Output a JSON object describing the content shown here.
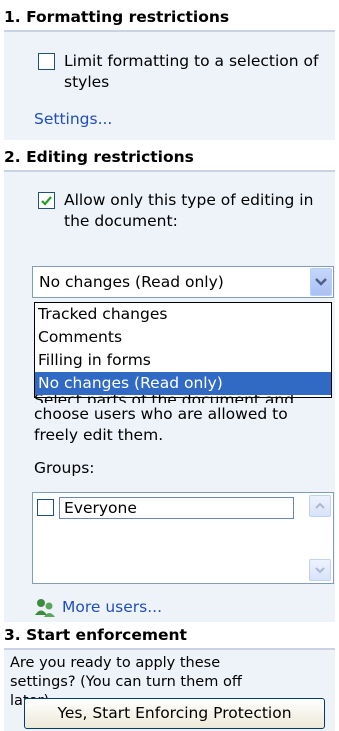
{
  "sections": {
    "formatting": {
      "title": "1. Formatting restrictions",
      "checkbox_line1": "Limit formatting to a selection of",
      "checkbox_line2": "styles",
      "checked": false,
      "settings_link": "Settings..."
    },
    "editing": {
      "title": "2. Editing restrictions",
      "checkbox_line1": "Allow only this type of editing in",
      "checkbox_line2": "the document:",
      "checked": true,
      "dropdown_value": "No changes (Read only)",
      "options": [
        "Tracked changes",
        "Comments",
        "Filling in forms",
        "No changes (Read only)"
      ],
      "selected_index": 3,
      "partial_hidden_line": "Select parts of the document and",
      "help_line1": "choose users who are allowed to",
      "help_line2": "freely edit them.",
      "groups_label": "Groups:",
      "groups": [
        "Everyone"
      ],
      "more_users_link": "More users..."
    },
    "enforcement": {
      "title": "3. Start enforcement",
      "text_line1": "Are you ready to apply these",
      "text_line2": "settings? (You can turn them off",
      "text_line3": "later)",
      "button_label": "Yes, Start Enforcing Protection"
    }
  },
  "colors": {
    "section_bg": "#eef2f9",
    "link": "#1f4fbf",
    "selection": "#316ac5",
    "check": "#21a121"
  },
  "icons": {
    "more_users": "users-icon",
    "dropdown": "chevron-down-icon",
    "scroll_up": "arrow-up-icon",
    "scroll_down": "arrow-down-icon",
    "checkmark": "checkmark-icon"
  }
}
